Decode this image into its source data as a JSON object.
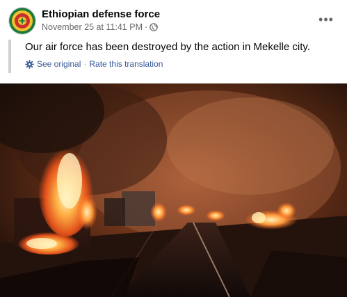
{
  "post": {
    "page_name": "Ethiopian defense force",
    "timestamp": "November 25 at 11:41 PM",
    "separator": "·",
    "audience_icon": "globe-icon",
    "more_options_icon": "more-horizontal-icon",
    "more_label": "•••"
  },
  "translation": {
    "text": "Our air force has been destroyed by the action in Mekelle city.",
    "settings_icon": "gear-icon",
    "see_original": "See original",
    "separator": "·",
    "rate": "Rate this translation"
  },
  "photo": {
    "description_icon": "burning-convoy-photo"
  },
  "colors": {
    "link": "#385898",
    "meta": "#65676b",
    "quote_bar": "#ced0d4",
    "flame": "#ff8a2a"
  }
}
